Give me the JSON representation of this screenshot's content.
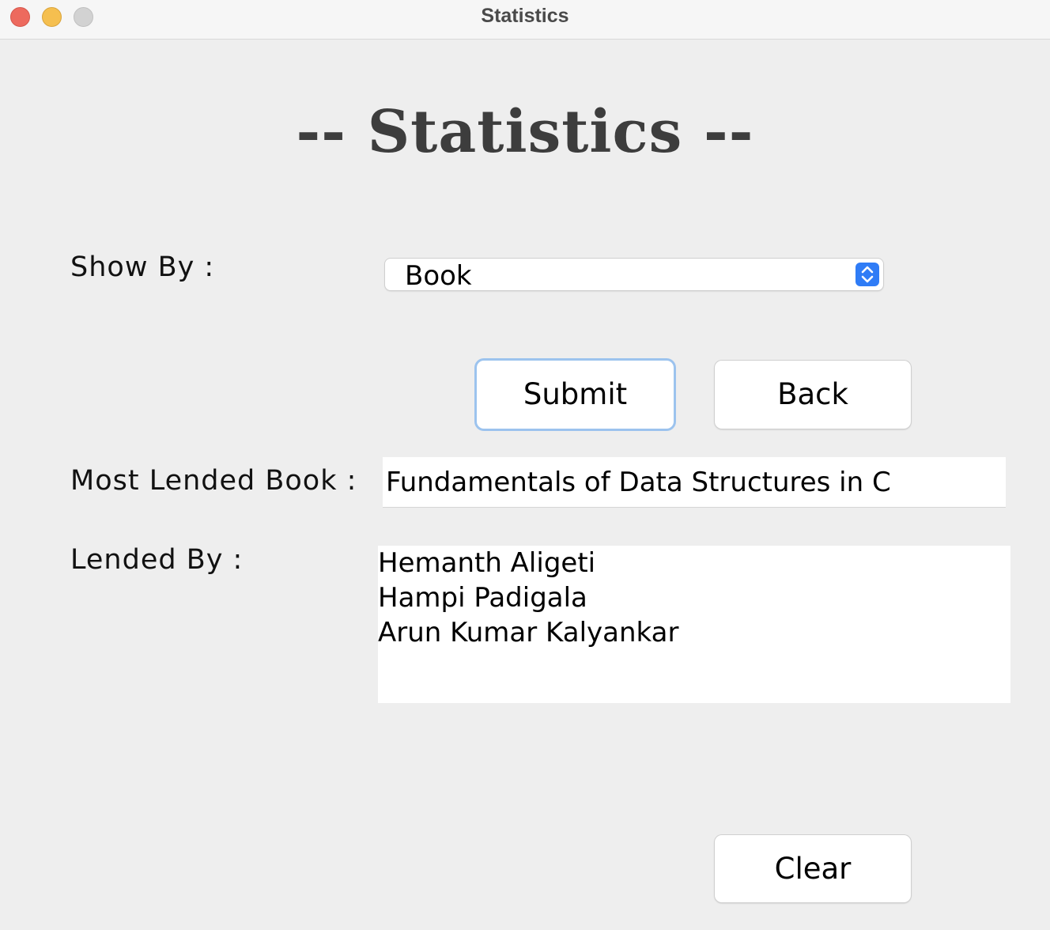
{
  "window": {
    "title": "Statistics"
  },
  "heading": "-- Statistics --",
  "show_by": {
    "label": "Show By :",
    "selected": "Book"
  },
  "buttons": {
    "submit": "Submit",
    "back": "Back",
    "clear": "Clear"
  },
  "most_lended": {
    "label": "Most Lended Book :",
    "value": "Fundamentals of Data Structures in C"
  },
  "lended_by": {
    "label": "Lended By :",
    "names": [
      "Hemanth Aligeti",
      "Hampi Padigala",
      "Arun Kumar Kalyankar"
    ]
  },
  "colors": {
    "select_arrow_accent": "#2f7cf6",
    "focus_ring": "#9cc3ee",
    "close": "#ed6a5e",
    "minimize": "#f5bf4f",
    "maximize": "#d2d2d2"
  }
}
